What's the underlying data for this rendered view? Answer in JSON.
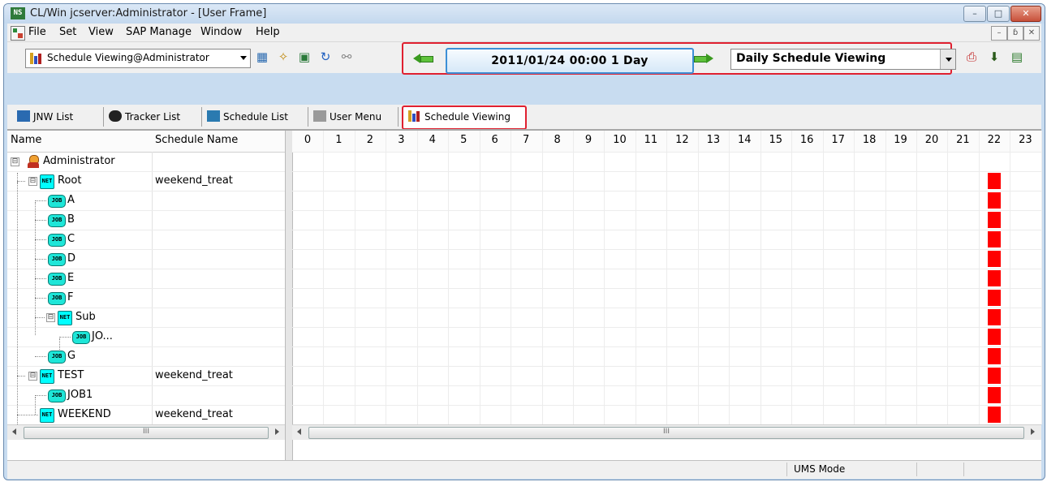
{
  "window": {
    "title": "CL/Win jcserver:Administrator - [User Frame]",
    "app_icon_text": "NS",
    "controls": {
      "minimize": "–",
      "maximize": "□",
      "close": "✕"
    }
  },
  "menubar": {
    "items": [
      "File",
      "Set",
      "View",
      "SAP Manage",
      "Window",
      "Help"
    ],
    "mdi_controls": {
      "minimize": "–",
      "restore": "ɓ",
      "close": "✕"
    }
  },
  "toolbar": {
    "frame_selector": "Schedule Viewing@Administrator",
    "date_range": "2011/01/24 00:00  1 Day",
    "view_mode": "Daily Schedule Viewing",
    "icons": [
      "schedule-list-icon",
      "wizard-icon",
      "calendar-icon",
      "refresh-icon",
      "find-icon",
      "print-icon",
      "export-icon",
      "report-icon"
    ]
  },
  "tabs": [
    {
      "label": "JNW List",
      "icon": "jnw-list-icon",
      "active": false
    },
    {
      "label": "Tracker List",
      "icon": "tracker-icon",
      "active": false
    },
    {
      "label": "Schedule List",
      "icon": "schedule-list-icon",
      "active": false
    },
    {
      "label": "User Menu",
      "icon": "user-menu-icon",
      "active": false
    },
    {
      "label": "Schedule Viewing",
      "icon": "schedule-viewing-icon",
      "active": true
    }
  ],
  "tree": {
    "columns": {
      "name": "Name",
      "schedule": "Schedule Name"
    },
    "rows": [
      {
        "label": "Administrator",
        "schedule": "",
        "type": "user"
      },
      {
        "label": "Root",
        "schedule": "weekend_treat",
        "type": "net"
      },
      {
        "label": "A",
        "schedule": "",
        "type": "job"
      },
      {
        "label": "B",
        "schedule": "",
        "type": "job"
      },
      {
        "label": "C",
        "schedule": "",
        "type": "job"
      },
      {
        "label": "D",
        "schedule": "",
        "type": "job"
      },
      {
        "label": "E",
        "schedule": "",
        "type": "job"
      },
      {
        "label": "F",
        "schedule": "",
        "type": "job"
      },
      {
        "label": "Sub",
        "schedule": "",
        "type": "net"
      },
      {
        "label": "JO...",
        "schedule": "",
        "type": "job"
      },
      {
        "label": "G",
        "schedule": "",
        "type": "job"
      },
      {
        "label": "TEST",
        "schedule": "weekend_treat",
        "type": "net"
      },
      {
        "label": "JOB1",
        "schedule": "",
        "type": "job"
      },
      {
        "label": "WEEKEND",
        "schedule": "weekend_treat",
        "type": "net"
      }
    ],
    "expander_symbol": "⊟",
    "job_icon_text": "JOB",
    "net_icon_text": "NET"
  },
  "timeline": {
    "hours": [
      "0",
      "1",
      "2",
      "3",
      "4",
      "5",
      "6",
      "7",
      "8",
      "9",
      "10",
      "11",
      "12",
      "13",
      "14",
      "15",
      "16",
      "17",
      "18",
      "19",
      "20",
      "21",
      "22",
      "23"
    ],
    "marked_hour": 22,
    "marked_row_indices": [
      1,
      2,
      3,
      4,
      5,
      6,
      7,
      8,
      9,
      10,
      11,
      12,
      13
    ],
    "mark_color": "#ff0000"
  },
  "scrollbars": {
    "thumb_grip": "III"
  },
  "status": {
    "mode": "UMS Mode"
  },
  "colors": {
    "highlight_border": "#e02030",
    "date_border": "#3d8fd6",
    "job_icon": "#00ffff"
  }
}
